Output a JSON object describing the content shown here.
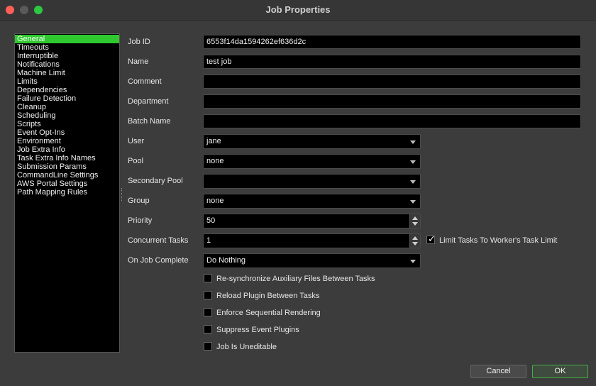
{
  "window": {
    "title": "Job Properties"
  },
  "sidebar": {
    "items": [
      {
        "label": "General",
        "selected": true
      },
      {
        "label": "Timeouts"
      },
      {
        "label": "Interruptible"
      },
      {
        "label": "Notifications"
      },
      {
        "label": "Machine Limit"
      },
      {
        "label": "Limits"
      },
      {
        "label": "Dependencies"
      },
      {
        "label": "Failure Detection"
      },
      {
        "label": "Cleanup"
      },
      {
        "label": "Scheduling"
      },
      {
        "label": "Scripts"
      },
      {
        "label": "Event Opt-Ins"
      },
      {
        "label": "Environment"
      },
      {
        "label": "Job Extra Info"
      },
      {
        "label": "Task Extra Info Names"
      },
      {
        "label": "Submission Params"
      },
      {
        "label": "CommandLine Settings"
      },
      {
        "label": "AWS Portal Settings"
      },
      {
        "label": "Path Mapping Rules"
      }
    ]
  },
  "form": {
    "job_id": {
      "label": "Job ID",
      "value": "6553f14da1594262ef636d2c"
    },
    "name": {
      "label": "Name",
      "value": "test job"
    },
    "comment": {
      "label": "Comment",
      "value": ""
    },
    "department": {
      "label": "Department",
      "value": ""
    },
    "batch_name": {
      "label": "Batch Name",
      "value": ""
    },
    "user": {
      "label": "User",
      "value": "jane"
    },
    "pool": {
      "label": "Pool",
      "value": "none"
    },
    "secondary_pool": {
      "label": "Secondary Pool",
      "value": ""
    },
    "group": {
      "label": "Group",
      "value": "none"
    },
    "priority": {
      "label": "Priority",
      "value": "50"
    },
    "concurrent_tasks": {
      "label": "Concurrent Tasks",
      "value": "1"
    },
    "limit_tasks": {
      "label": "Limit Tasks To Worker's Task Limit",
      "checked": true
    },
    "on_job_complete": {
      "label": "On Job Complete",
      "value": "Do Nothing"
    }
  },
  "options": [
    {
      "label": "Re-synchronize Auxiliary Files Between Tasks",
      "checked": false
    },
    {
      "label": "Reload Plugin Between Tasks",
      "checked": false
    },
    {
      "label": "Enforce Sequential Rendering",
      "checked": false
    },
    {
      "label": "Suppress Event Plugins",
      "checked": false
    },
    {
      "label": "Job Is Uneditable",
      "checked": false
    }
  ],
  "buttons": {
    "cancel": "Cancel",
    "ok": "OK"
  },
  "colors": {
    "accent": "#2fc92f",
    "background": "#3c3c3c",
    "field": "#000000"
  }
}
